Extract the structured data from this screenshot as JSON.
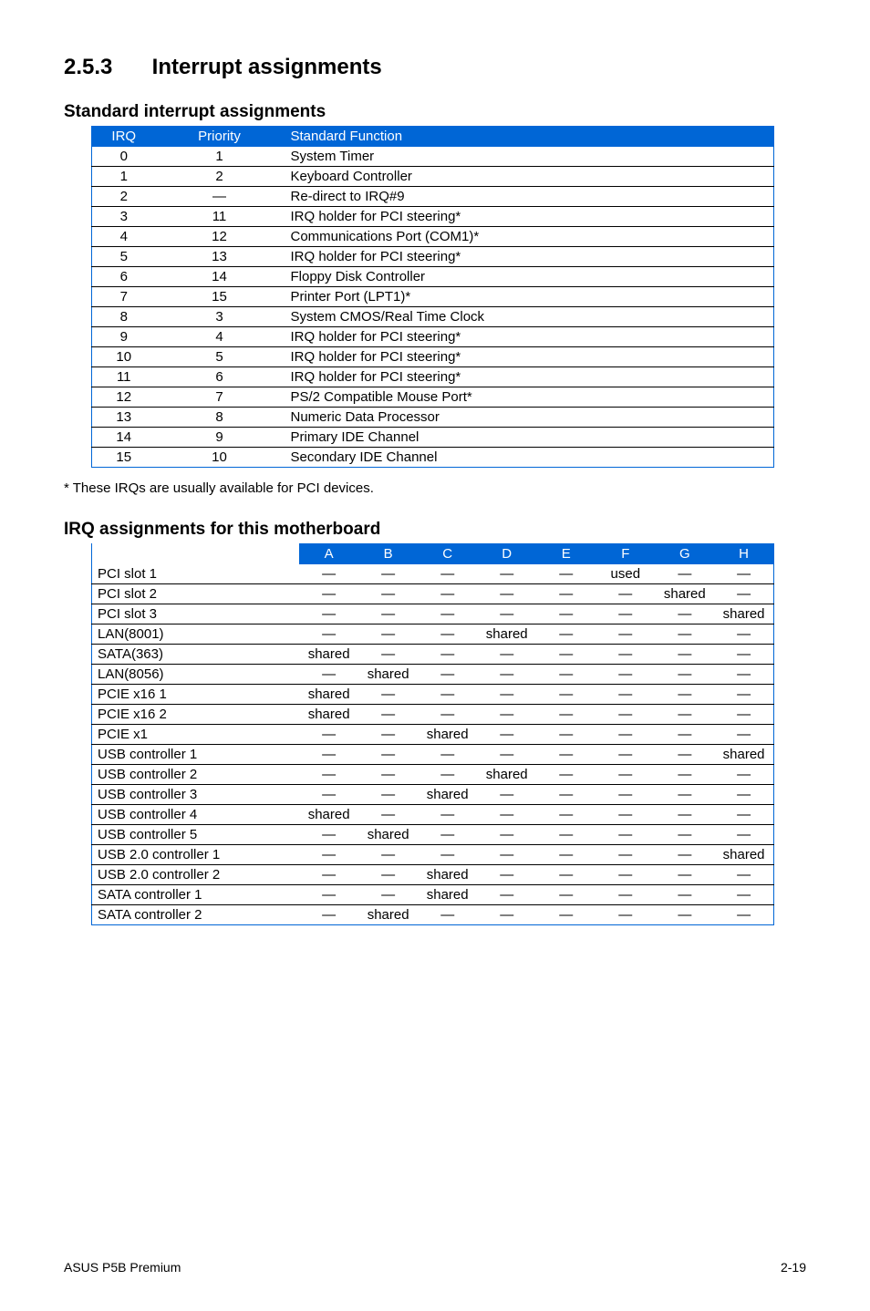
{
  "section": {
    "number": "2.5.3",
    "title": "Interrupt assignments"
  },
  "sub1": "Standard interrupt assignments",
  "stdHeaders": {
    "irq": "IRQ",
    "priority": "Priority",
    "func": "Standard Function"
  },
  "stdRows": [
    {
      "irq": "0",
      "pri": "1",
      "func": "System Timer"
    },
    {
      "irq": "1",
      "pri": "2",
      "func": "Keyboard Controller"
    },
    {
      "irq": "2",
      "pri": "—",
      "func": "Re-direct to IRQ#9"
    },
    {
      "irq": "3",
      "pri": "11",
      "func": "IRQ holder for PCI steering*"
    },
    {
      "irq": "4",
      "pri": "12",
      "func": "Communications Port (COM1)*"
    },
    {
      "irq": "5",
      "pri": "13",
      "func": "IRQ holder for PCI steering*"
    },
    {
      "irq": "6",
      "pri": "14",
      "func": "Floppy Disk Controller"
    },
    {
      "irq": "7",
      "pri": "15",
      "func": "Printer Port (LPT1)*"
    },
    {
      "irq": "8",
      "pri": "3",
      "func": "System CMOS/Real Time Clock"
    },
    {
      "irq": "9",
      "pri": "4",
      "func": "IRQ holder for PCI steering*"
    },
    {
      "irq": "10",
      "pri": "5",
      "func": "IRQ holder for PCI steering*"
    },
    {
      "irq": "11",
      "pri": "6",
      "func": "IRQ holder for PCI steering*"
    },
    {
      "irq": "12",
      "pri": "7",
      "func": "PS/2 Compatible Mouse Port*"
    },
    {
      "irq": "13",
      "pri": "8",
      "func": "Numeric Data Processor"
    },
    {
      "irq": "14",
      "pri": "9",
      "func": "Primary IDE Channel"
    },
    {
      "irq": "15",
      "pri": "10",
      "func": "Secondary IDE Channel"
    }
  ],
  "footnote": "* These IRQs are usually available for PCI devices.",
  "sub2": "IRQ assignments for this motherboard",
  "irqCols": [
    "A",
    "B",
    "C",
    "D",
    "E",
    "F",
    "G",
    "H"
  ],
  "irqRows": [
    {
      "label": "PCI slot 1",
      "v": [
        "—",
        "—",
        "—",
        "—",
        "—",
        "used",
        "—",
        "—"
      ]
    },
    {
      "label": "PCI slot 2",
      "v": [
        "—",
        "—",
        "—",
        "—",
        "—",
        "—",
        "shared",
        "—"
      ]
    },
    {
      "label": "PCI slot 3",
      "v": [
        "—",
        "—",
        "—",
        "—",
        "—",
        "—",
        "—",
        "shared"
      ]
    },
    {
      "label": "LAN(8001)",
      "v": [
        "—",
        "—",
        "—",
        "shared",
        "—",
        "—",
        "—",
        "—"
      ]
    },
    {
      "label": "SATA(363)",
      "v": [
        "shared",
        "—",
        "—",
        "—",
        "—",
        "—",
        "—",
        "—"
      ]
    },
    {
      "label": "LAN(8056)",
      "v": [
        "—",
        "shared",
        "—",
        "—",
        "—",
        "—",
        "—",
        "—"
      ]
    },
    {
      "label": "PCIE x16 1",
      "v": [
        "shared",
        "—",
        "—",
        "—",
        "—",
        "—",
        "—",
        "—"
      ]
    },
    {
      "label": "PCIE x16 2",
      "v": [
        "shared",
        "—",
        "—",
        "—",
        "—",
        "—",
        "—",
        "—"
      ]
    },
    {
      "label": "PCIE x1",
      "v": [
        "—",
        "—",
        "shared",
        "—",
        "—",
        "—",
        "—",
        "—"
      ]
    },
    {
      "label": "USB controller 1",
      "v": [
        "—",
        "—",
        "—",
        "—",
        "—",
        "—",
        "—",
        "shared"
      ]
    },
    {
      "label": "USB controller 2",
      "v": [
        "—",
        "—",
        "—",
        "shared",
        "—",
        "—",
        "—",
        "—"
      ]
    },
    {
      "label": "USB controller 3",
      "v": [
        "—",
        "—",
        "shared",
        "—",
        "—",
        "—",
        "—",
        "—"
      ]
    },
    {
      "label": "USB controller 4",
      "v": [
        "shared",
        "—",
        "—",
        "—",
        "—",
        "—",
        "—",
        "—"
      ]
    },
    {
      "label": "USB controller 5",
      "v": [
        "—",
        "shared",
        "—",
        "—",
        "—",
        "—",
        "—",
        "—"
      ]
    },
    {
      "label": "USB 2.0 controller 1",
      "v": [
        "—",
        "—",
        "—",
        "—",
        "—",
        "—",
        "—",
        "shared"
      ]
    },
    {
      "label": "USB 2.0 controller 2",
      "v": [
        "—",
        "—",
        "shared",
        "—",
        "—",
        "—",
        "—",
        "—"
      ]
    },
    {
      "label": "SATA controller 1",
      "v": [
        "—",
        "—",
        "shared",
        "—",
        "—",
        "—",
        "—",
        "—"
      ]
    },
    {
      "label": "SATA controller 2",
      "v": [
        "—",
        "shared",
        "—",
        "—",
        "—",
        "—",
        "—",
        "—"
      ]
    }
  ],
  "footer": {
    "left": "ASUS P5B Premium",
    "right": "2-19"
  }
}
